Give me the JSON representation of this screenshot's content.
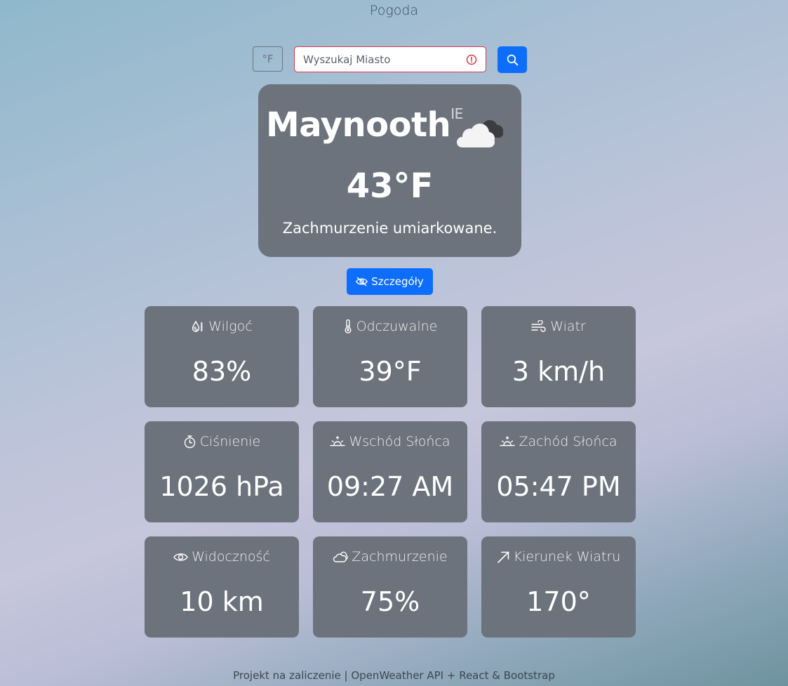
{
  "app": {
    "title": "Pogoda"
  },
  "controls": {
    "unit_toggle_label": "°F",
    "search_placeholder": "Wyszukaj Miasto",
    "search_value": ""
  },
  "current": {
    "city": "Maynooth",
    "country": "IE",
    "temperature": "43°F",
    "description": "Zachmurzenie umiarkowane.",
    "icon": "cloud-icon"
  },
  "details_button": {
    "label": "Szczegóły",
    "icon": "eye-slash-icon"
  },
  "details": [
    {
      "label": "Wilgoć",
      "value": "83%",
      "icon": "humidity-icon"
    },
    {
      "label": "Odczuwalne",
      "value": "39°F",
      "icon": "thermometer-icon"
    },
    {
      "label": "Wiatr",
      "value": "3 km/h",
      "icon": "wind-icon"
    },
    {
      "label": "Ciśnienie",
      "value": "1026 hPa",
      "icon": "stopwatch-icon"
    },
    {
      "label": "Wschód Słońca",
      "value": "09:27 AM",
      "icon": "sunrise-icon"
    },
    {
      "label": "Zachód Słońca",
      "value": "05:47 PM",
      "icon": "sunset-icon"
    },
    {
      "label": "Widoczność",
      "value": "10 km",
      "icon": "eye-icon"
    },
    {
      "label": "Zachmurzenie",
      "value": "75%",
      "icon": "clouds-icon"
    },
    {
      "label": "Kierunek Wiatru",
      "value": "170°",
      "icon": "arrow-up-right-icon"
    }
  ],
  "footer": {
    "text": "Projekt na zaliczenie | OpenWeather API + React & Bootstrap"
  },
  "colors": {
    "accent": "#0d6efd",
    "card": "#6c737c",
    "error": "#dc3545"
  }
}
